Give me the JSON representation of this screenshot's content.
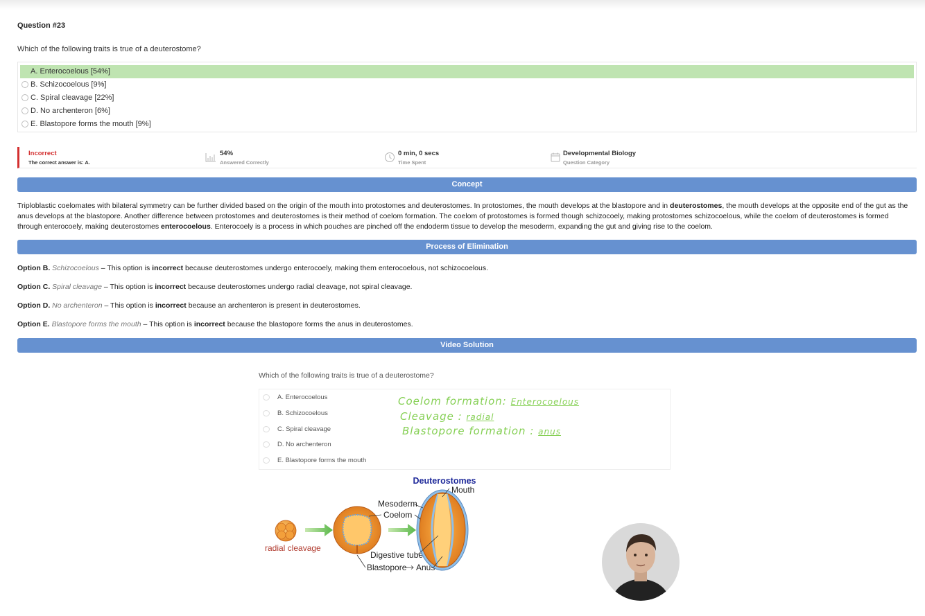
{
  "question": {
    "number": "Question #23",
    "text": "Which of the following traits is true of a deuterostome?",
    "options": [
      {
        "label": "A. Enterocoelous [54%]",
        "correct": true
      },
      {
        "label": "B. Schizocoelous [9%]",
        "correct": false
      },
      {
        "label": "C. Spiral cleavage [22%]",
        "correct": false
      },
      {
        "label": "D. No archenteron [6%]",
        "correct": false
      },
      {
        "label": "E. Blastopore forms the mouth [9%]",
        "correct": false
      }
    ]
  },
  "stats": {
    "result": "Incorrect",
    "correct_answer": "The correct answer is: A.",
    "percent": "54%",
    "percent_label": "Answered Correctly",
    "time": "0 min, 0 secs",
    "time_label": "Time Spent",
    "category": "Developmental Biology",
    "category_label": "Question Category"
  },
  "sections": {
    "concept": "Concept",
    "elimination": "Process of Elimination",
    "video": "Video Solution"
  },
  "concept": {
    "p1": "Triploblastic coelomates with bilateral symmetry can be further divided based on the origin of the mouth into protostomes and deuterostomes. In protostomes, the mouth develops at the blastopore and in ",
    "b1": "deuterostomes",
    "p2": ", the mouth develops at the opposite end of the gut as the anus develops at the blastopore. Another difference between protostomes and deuterostomes is their method of coelom formation. The coelom of protostomes is formed though schizocoely, making protostomes schizocoelous, while the coelom of deuterostomes is formed through enterocoely, making deuterostomes ",
    "b2": "enterocoelous",
    "p3": ". Enterocoely is a process in which pouches are pinched off the endoderm tissue to develop the mesoderm, expanding the gut and giving rise to the coelom."
  },
  "elimination": [
    {
      "option": "Option B.",
      "term": "Schizocoelous",
      "pre": " – This option is ",
      "bold": "incorrect",
      "post": " because deuterostomes undergo enterocoely, making them enterocoelous, not schizocoelous."
    },
    {
      "option": "Option C.",
      "term": "Spiral cleavage",
      "pre": " – This option is ",
      "bold": "incorrect",
      "post": " because deuterostomes undergo radial cleavage, not spiral cleavage."
    },
    {
      "option": "Option D.",
      "term": "No archenteron",
      "pre": " – This option is ",
      "bold": "incorrect",
      "post": " because an archenteron is present in deuterostomes."
    },
    {
      "option": "Option E.",
      "term": "Blastopore forms the mouth",
      "pre": " – This option is ",
      "bold": "incorrect",
      "post": " because the blastopore forms the anus in deuterostomes."
    }
  ],
  "video": {
    "question": "Which of the following traits is true of a deuterostome?",
    "options": [
      "A. Enterocoelous",
      "B. Schizocoelous",
      "C. Spiral cleavage",
      "D. No archenteron",
      "E. Blastopore forms the mouth"
    ],
    "notes": [
      {
        "label": "Coelom formation:",
        "answer": "Enterocoelous"
      },
      {
        "label": "Cleavage :",
        "answer": "radial"
      },
      {
        "label": "Blastopore formation :",
        "answer": "anus"
      }
    ],
    "diagram": {
      "title": "Deuterostomes",
      "mouth": "Mouth",
      "mesoderm": "Mesoderm",
      "coelom": "Coelom",
      "radial": "radial cleavage",
      "digestive": "Digestive tube",
      "blastopore": "Blastopore",
      "anus": "Anus"
    }
  },
  "colors": {
    "accent": "#6691d0",
    "correct_bg": "#bfe4b1",
    "incorrect": "#d32f2f",
    "handwriting": "#86d055"
  }
}
